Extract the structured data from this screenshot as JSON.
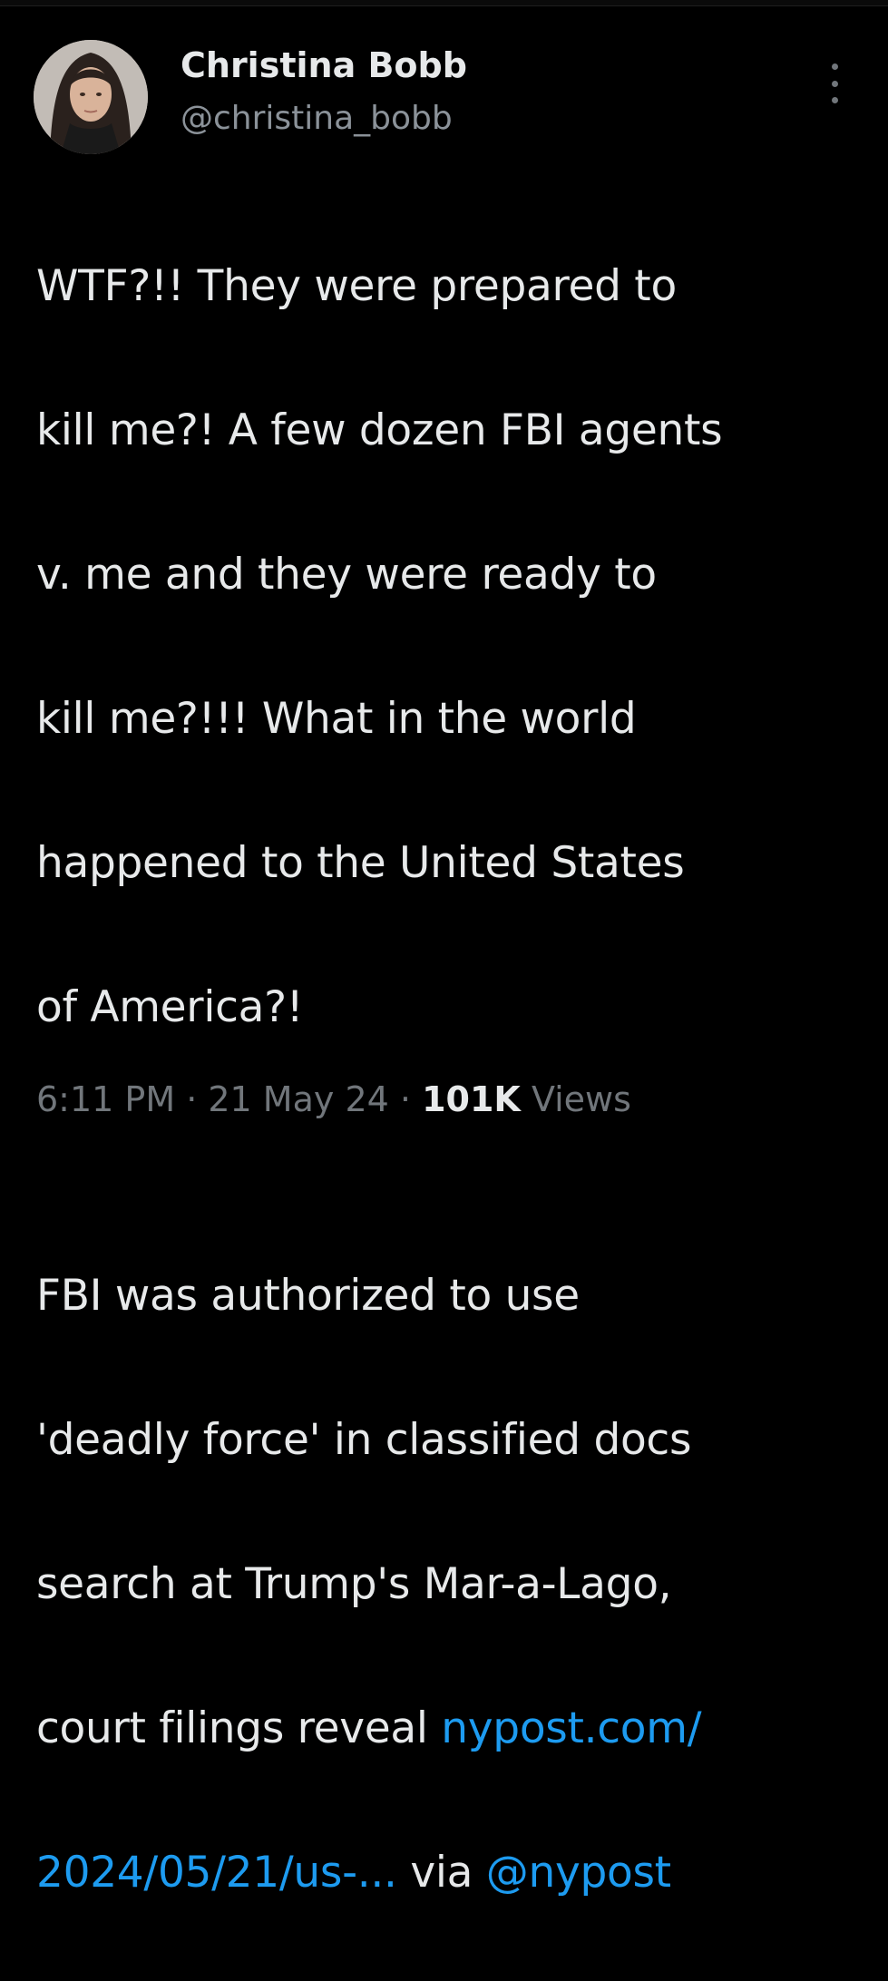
{
  "author": {
    "display_name": "Christina Bobb",
    "handle": "@christina_bobb"
  },
  "icons": {
    "more": "more-vertical-icon"
  },
  "tweet": {
    "lines": [
      "WTF?!! They were prepared to",
      "kill me?! A few dozen FBI agents",
      "v. me and they were ready to",
      "kill me?!!!  What in the world",
      "happened to the United States",
      "of America?!",
      "FBI was authorized to use",
      "'deadly force' in classified docs",
      "search at Trump's Mar-a-Lago,",
      "court filings reveal "
    ],
    "link_part1": "nypost.com/",
    "link_part2": "2024/05/21/us-...",
    "via_text": " via ",
    "mention": "@nypost"
  },
  "meta": {
    "time": "6:11 PM",
    "separator": " · ",
    "date": "21 May 24",
    "views_count": "101K",
    "views_label": "Views"
  },
  "colors": {
    "background": "#000000",
    "text": "#e7e9ea",
    "secondary": "#71767b",
    "link": "#1d9bf0"
  }
}
